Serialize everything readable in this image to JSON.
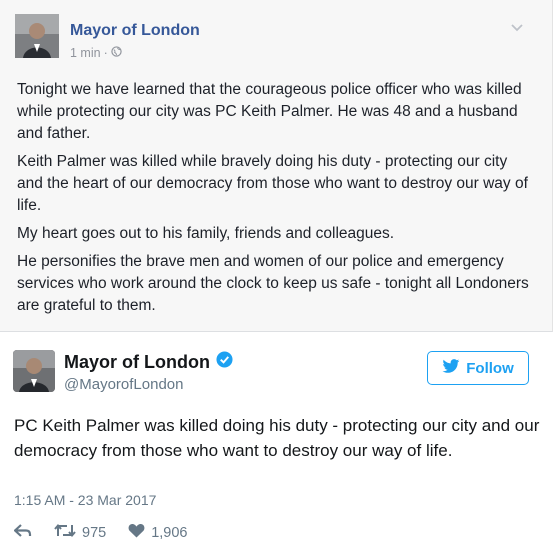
{
  "facebook_post": {
    "author": "Mayor of London",
    "time": "1 min",
    "separator": "·",
    "paragraphs": [
      "Tonight we have learned that the courageous police officer who was killed while protecting our city was PC Keith Palmer. He was 48 and a husband and father.",
      "Keith Palmer was killed while bravely doing his duty - protecting our city and the heart of our democracy from those who want to destroy our way of life.",
      "My heart goes out to his family, friends and colleagues.",
      "He personifies the brave men and women of our police and emergency services who work around the clock to keep us safe - tonight all Londoners are grateful to them."
    ]
  },
  "tweet": {
    "display_name": "Mayor of London",
    "handle": "@MayorofLondon",
    "follow_label": "Follow",
    "text": "PC Keith Palmer was killed doing his duty - protecting our city and our democracy from those who want to destroy our way of life.",
    "timestamp": "1:15 AM - 23 Mar 2017",
    "retweets": "975",
    "likes": "1,906"
  },
  "colors": {
    "facebook_link": "#365899",
    "twitter_blue": "#1da1f2",
    "muted": "#657786"
  }
}
